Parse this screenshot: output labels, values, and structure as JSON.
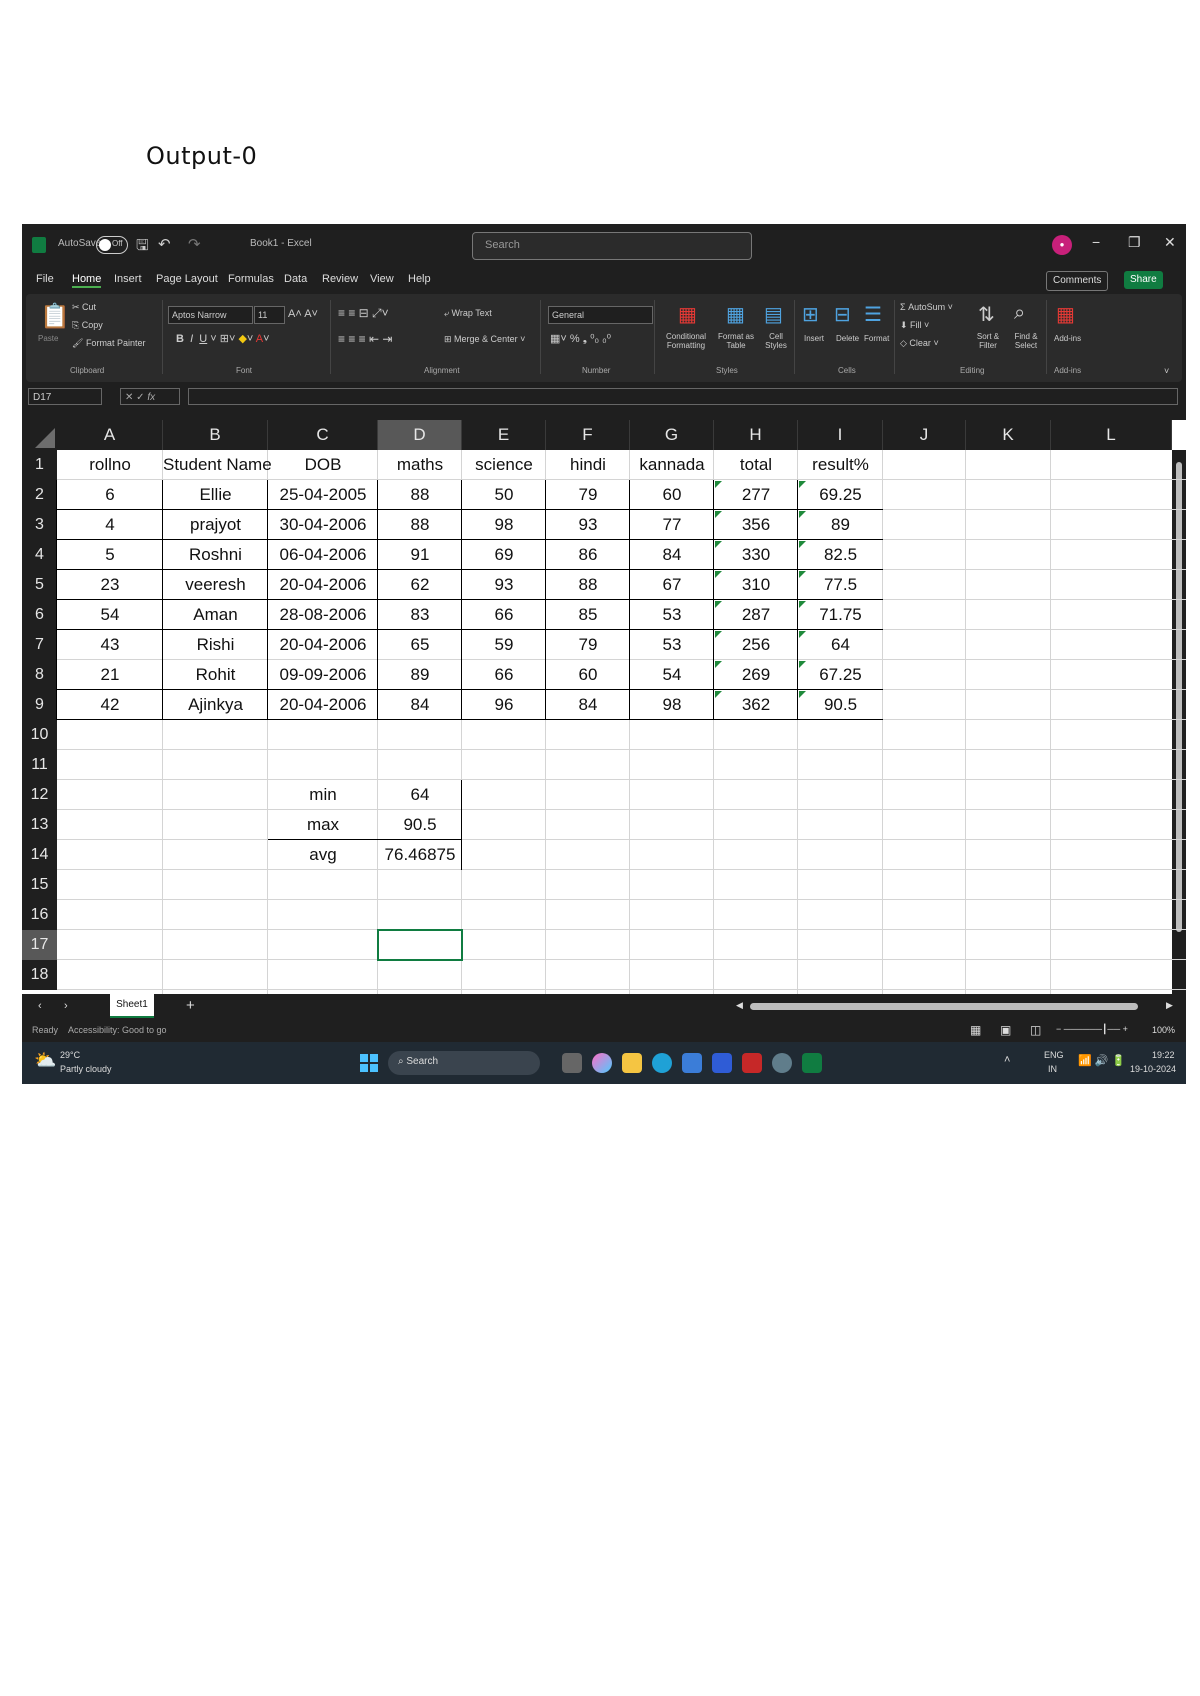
{
  "page_heading": "Output-0",
  "window": {
    "autosave_label": "AutoSave",
    "autosave_state": "Off",
    "file_name": "Book1 - Excel",
    "search_placeholder": "Search",
    "comments_label": "Comments",
    "share_label": "Share"
  },
  "menu": [
    "File",
    "Home",
    "Insert",
    "Page Layout",
    "Formulas",
    "Data",
    "Review",
    "View",
    "Help"
  ],
  "ribbon": {
    "cut": "Cut",
    "copy": "Copy",
    "format_painter": "Format Painter",
    "paste": "Paste",
    "font_name": "Aptos Narrow",
    "font_size": "11",
    "wrap_text": "Wrap Text",
    "merge_center": "Merge & Center",
    "number_format": "General",
    "conditional_formatting": "Conditional Formatting",
    "format_as_table": "Format as Table",
    "cell_styles": "Cell Styles",
    "insert": "Insert",
    "delete": "Delete",
    "format": "Format",
    "autosum": "AutoSum",
    "fill": "Fill",
    "clear": "Clear",
    "sort_filter": "Sort & Filter",
    "find_select": "Find & Select",
    "addins": "Add-ins",
    "groups": [
      "Clipboard",
      "Font",
      "Alignment",
      "Number",
      "Styles",
      "Cells",
      "Editing",
      "Add-ins"
    ]
  },
  "formula_bar": {
    "name_box": "D17",
    "value": ""
  },
  "columns": [
    "A",
    "B",
    "C",
    "D",
    "E",
    "F",
    "G",
    "H",
    "I",
    "J",
    "K",
    "L"
  ],
  "rows": [
    "1",
    "2",
    "3",
    "4",
    "5",
    "6",
    "7",
    "8",
    "9",
    "10",
    "11",
    "12",
    "13",
    "14",
    "15",
    "16",
    "17",
    "18"
  ],
  "table": {
    "headers": [
      "rollno",
      "Student Name",
      "DOB",
      "maths",
      "science",
      "hindi",
      "kannada",
      "total",
      "result%"
    ],
    "records": [
      [
        "6",
        "Ellie",
        "25-04-2005",
        "88",
        "50",
        "79",
        "60",
        "277",
        "69.25"
      ],
      [
        "4",
        "prajyot",
        "30-04-2006",
        "88",
        "98",
        "93",
        "77",
        "356",
        "89"
      ],
      [
        "5",
        "Roshni",
        "06-04-2006",
        "91",
        "69",
        "86",
        "84",
        "330",
        "82.5"
      ],
      [
        "23",
        "veeresh",
        "20-04-2006",
        "62",
        "93",
        "88",
        "67",
        "310",
        "77.5"
      ],
      [
        "54",
        "Aman",
        "28-08-2006",
        "83",
        "66",
        "85",
        "53",
        "287",
        "71.75"
      ],
      [
        "43",
        "Rishi",
        "20-04-2006",
        "65",
        "59",
        "79",
        "53",
        "256",
        "64"
      ],
      [
        "21",
        "Rohit",
        "09-09-2006",
        "89",
        "66",
        "60",
        "54",
        "269",
        "67.25"
      ],
      [
        "42",
        "Ajinkya",
        "20-04-2006",
        "84",
        "96",
        "84",
        "98",
        "362",
        "90.5"
      ]
    ]
  },
  "stats": [
    {
      "label": "min",
      "value": "64"
    },
    {
      "label": "max",
      "value": "90.5"
    },
    {
      "label": "avg",
      "value": "76.46875"
    }
  ],
  "sheet_tab": "Sheet1",
  "status": {
    "ready": "Ready",
    "accessibility": "Accessibility: Good to go",
    "zoom": "100%"
  },
  "taskbar": {
    "weather_temp": "29°C",
    "weather_desc": "Partly cloudy",
    "search": "Search",
    "lang": "ENG",
    "region": "IN",
    "time": "19:22",
    "date": "19-10-2024"
  },
  "colors": {
    "excel_green": "#107c41",
    "avatar": "#c8207a",
    "dark_bg": "#1f1f1f",
    "ribbon_bg": "#2b2b2b"
  }
}
